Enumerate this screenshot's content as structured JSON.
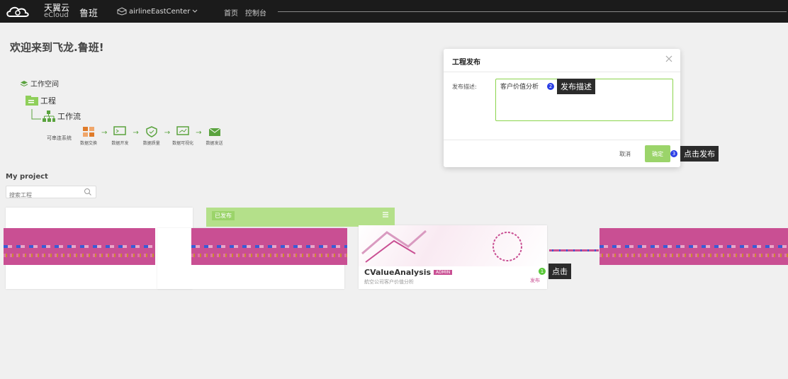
{
  "header": {
    "logo_name": "天翼云",
    "logo_eng": "eCloud",
    "brand": "鲁班",
    "product_select": "airlineEastCenter",
    "nav": [
      "首页",
      "控制台"
    ],
    "bg_color": "#1b1b1b"
  },
  "welcome": {
    "title": "欢迎来到飞龙.鲁班!",
    "tree": [
      "工作空间",
      "工程",
      "工作流"
    ],
    "flow_label": "可串连系统",
    "flow_steps": [
      "数据交换",
      "数据开发",
      "数据质量",
      "数据可视化",
      "数据发送"
    ]
  },
  "projects": {
    "title": "My project",
    "search_placeholder": "搜索工程",
    "green_card_tag": "已发布",
    "cv_card": {
      "title": "CValueAnalysis",
      "badge": "ADMIN",
      "desc": "航空公司客户价值分析",
      "publish": "发布"
    }
  },
  "callouts": {
    "c1": {
      "num": "1",
      "text": "点击",
      "color": "#5ac83a"
    },
    "c2": {
      "num": "2",
      "text": "发布描述",
      "color": "#2a3ee6"
    },
    "c3": {
      "num": "3",
      "text": "点击发布",
      "color": "#2a3ee6"
    }
  },
  "dialog": {
    "title": "工程发布",
    "desc_label": "发布描述:",
    "desc_value": "客户价值分析",
    "cancel": "取消",
    "confirm": "确定",
    "accent": "#9bd46a"
  }
}
